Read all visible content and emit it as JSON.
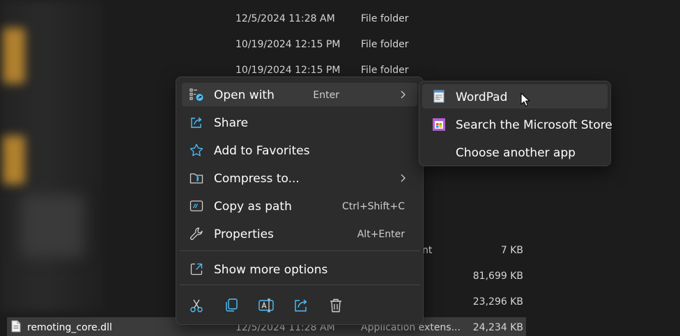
{
  "explorer": {
    "rows": [
      {
        "date": "12/5/2024 11:28 AM",
        "type": "File folder"
      },
      {
        "date": "10/19/2024 12:15 PM",
        "type": "File folder"
      },
      {
        "date": "10/19/2024 12:15 PM",
        "type": "File folder"
      }
    ],
    "partial_rows": [
      {
        "type_fragment": "nt",
        "size": "7 KB"
      },
      {
        "size": "81,699 KB"
      },
      {
        "size": "23,296 KB"
      }
    ],
    "selected_file": {
      "name": "remoting_core.dll",
      "date": "12/5/2024 11:28 AM",
      "type": "Application extens...",
      "size": "24,234 KB"
    }
  },
  "context_menu": {
    "items": [
      {
        "label": "Open with",
        "shortcut": "Enter",
        "icon": "open-with-icon",
        "submenu": true
      },
      {
        "label": "Share",
        "icon": "share-icon"
      },
      {
        "label": "Add to Favorites",
        "icon": "star-icon"
      },
      {
        "label": "Compress to...",
        "icon": "zip-folder-icon",
        "submenu": true
      },
      {
        "label": "Copy as path",
        "shortcut": "Ctrl+Shift+C",
        "icon": "copy-path-icon"
      },
      {
        "label": "Properties",
        "shortcut": "Alt+Enter",
        "icon": "wrench-icon"
      },
      {
        "label": "Show more options",
        "icon": "show-more-icon"
      }
    ],
    "quick_actions": [
      "cut-icon",
      "copy-icon",
      "rename-icon",
      "share-icon",
      "delete-icon"
    ]
  },
  "open_with_submenu": {
    "items": [
      {
        "label": "WordPad",
        "icon": "wordpad-icon"
      },
      {
        "label": "Search the Microsoft Store",
        "icon": "microsoft-store-icon"
      },
      {
        "label": "Choose another app"
      }
    ]
  },
  "colors": {
    "accent": "#4cc2ff",
    "menu_bg": "#2c2c2c",
    "hover_bg": "#3a3a3a",
    "folder": "#c9912f"
  }
}
